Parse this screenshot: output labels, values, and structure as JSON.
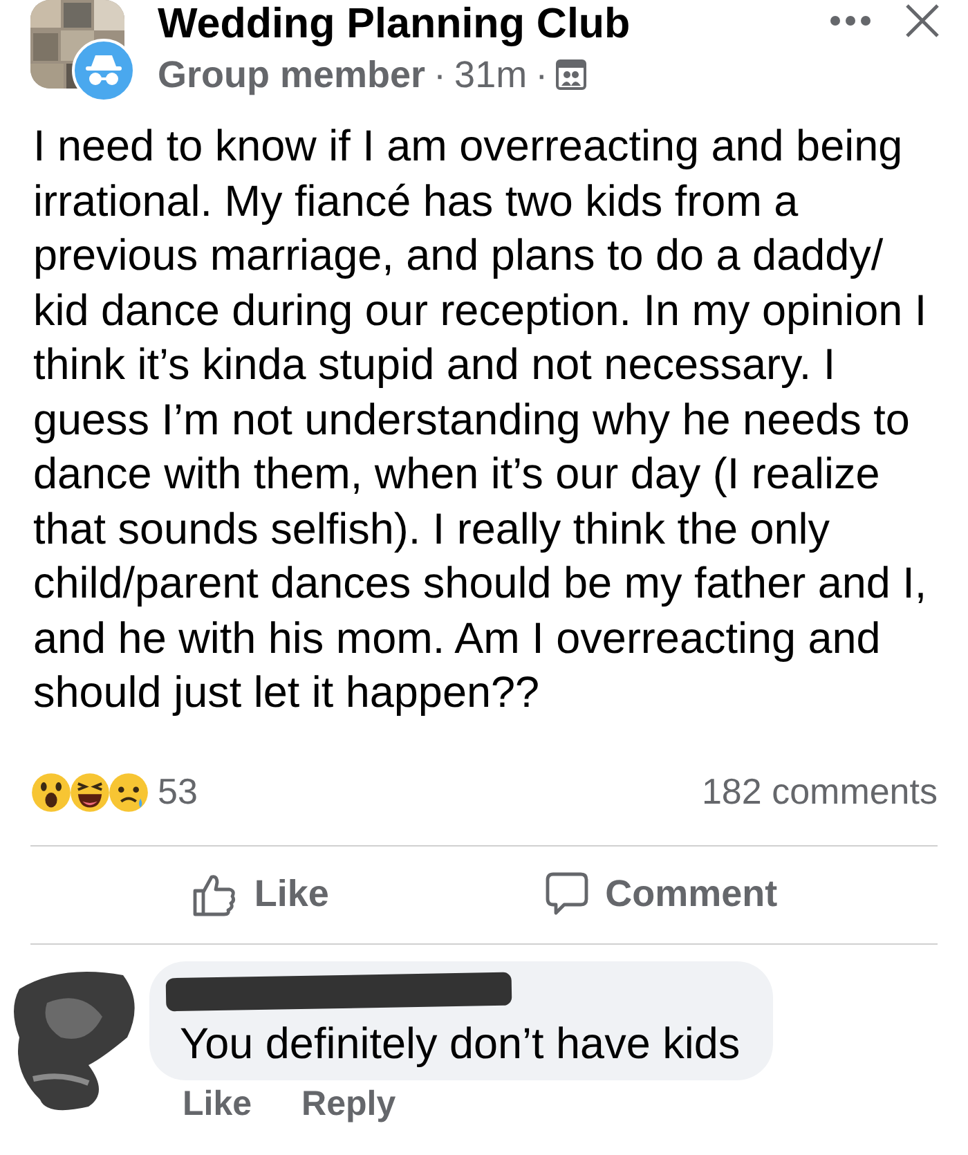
{
  "post": {
    "group_name": "Wedding Planning Club",
    "author": "Group member",
    "time": "31m",
    "separator": "·",
    "body": "I need to know if I am overreacting and being irrational. My fiancé has two kids from a previous marriage, and plans to do a daddy/ kid dance during our reception. In my opinion I think it’s kinda stupid and not necessary. I guess I’m not understanding why he needs to dance with them, when it’s our day (I realize that sounds selfish). I really think the only child/parent dances should be my father and I, and he with his mom. Am I overreacting and should just let it happen??",
    "reactions": [
      {
        "kind": "wow"
      },
      {
        "kind": "haha"
      },
      {
        "kind": "sad"
      }
    ],
    "reaction_count": "53",
    "comment_count": "182 comments"
  },
  "actions": [
    {
      "kind": "like",
      "label": "Like"
    },
    {
      "kind": "comment",
      "label": "Comment"
    }
  ],
  "comment": {
    "name_redacted": true,
    "text": "You definitely don’t have kids",
    "actions": [
      "Like",
      "Reply"
    ]
  }
}
